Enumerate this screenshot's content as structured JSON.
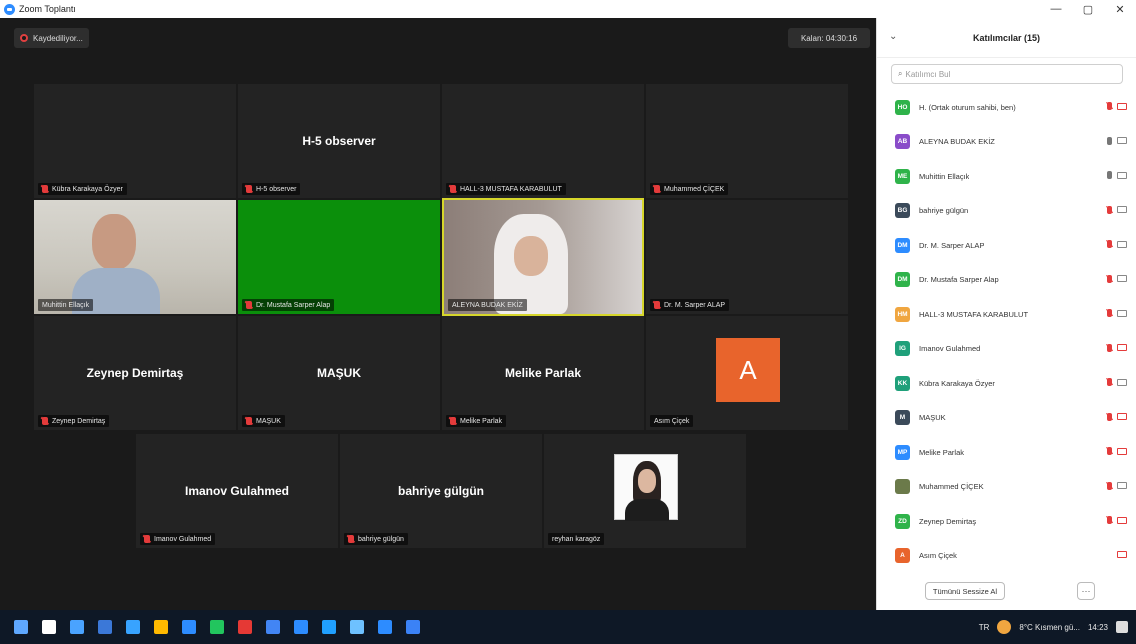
{
  "window": {
    "title": "Zoom Toplantı",
    "controls": [
      "—",
      "▢",
      "✕"
    ]
  },
  "recording": {
    "label": "Kaydediliyor..."
  },
  "timer": {
    "label": "Kalan: 04:30:16"
  },
  "tiles": [
    {
      "center": "",
      "label": "Kübra Karakaya Özyer",
      "muted": true
    },
    {
      "center": "H-5 observer",
      "label": "H-5 observer",
      "muted": true
    },
    {
      "center": "",
      "label": "HALL-3 MUSTAFA KARABULUT",
      "muted": true
    },
    {
      "center": "",
      "label": "Muhammed ÇİÇEK",
      "muted": true
    },
    {
      "center": "",
      "label": "Muhittin Ellaçık",
      "muted": false
    },
    {
      "center": "",
      "label": "Dr. Mustafa Sarper Alap",
      "muted": true
    },
    {
      "center": "",
      "label": "ALEYNA BUDAK EKİZ",
      "muted": false
    },
    {
      "center": "",
      "label": "Dr. M. Sarper ALAP",
      "muted": true
    },
    {
      "center": "Zeynep Demirtaş",
      "label": "Zeynep Demirtaş",
      "muted": true
    },
    {
      "center": "MAŞUK",
      "label": "MAŞUK",
      "muted": true
    },
    {
      "center": "Melike Parlak",
      "label": "Melike Parlak",
      "muted": true
    },
    {
      "center": "A",
      "label": "Asım Çiçek",
      "muted": false
    },
    {
      "center": "Imanov Gulahmed",
      "label": "Imanov Gulahmed",
      "muted": true
    },
    {
      "center": "bahriye gülgün",
      "label": "bahriye gülgün",
      "muted": true
    },
    {
      "center": "",
      "label": "reyhan karagöz",
      "muted": false
    }
  ],
  "panel": {
    "title": "Katılımcılar (15)",
    "search_placeholder": "Katılımcı Bul",
    "participants": [
      {
        "initials": "HO",
        "name": "H. (Ortak oturum sahibi, ben)",
        "color": "#2fb34a",
        "mic": "off",
        "cam": "off"
      },
      {
        "initials": "AB",
        "name": "ALEYNA BUDAK EKİZ",
        "color": "#8a4cc9",
        "mic": "on",
        "cam": "on"
      },
      {
        "initials": "ME",
        "name": "Muhittin Ellaçık",
        "color": "#2fb34a",
        "mic": "on",
        "cam": "on"
      },
      {
        "initials": "BG",
        "name": "bahriye gülgün",
        "color": "#3b4a5a",
        "mic": "off",
        "cam": "on"
      },
      {
        "initials": "DM",
        "name": "Dr. M. Sarper ALAP",
        "color": "#2d8cff",
        "mic": "off",
        "cam": "on"
      },
      {
        "initials": "DM",
        "name": "Dr. Mustafa Sarper Alap",
        "color": "#2fb34a",
        "mic": "off",
        "cam": "on"
      },
      {
        "initials": "HM",
        "name": "HALL-3 MUSTAFA KARABULUT",
        "color": "#f0a640",
        "mic": "off",
        "cam": "on"
      },
      {
        "initials": "IG",
        "name": "Imanov Gulahmed",
        "color": "#1fa07a",
        "mic": "off",
        "cam": "off"
      },
      {
        "initials": "KK",
        "name": "Kübra Karakaya Özyer",
        "color": "#1fa07a",
        "mic": "off",
        "cam": "on"
      },
      {
        "initials": "M",
        "name": "MAŞUK",
        "color": "#3b4a5a",
        "mic": "off",
        "cam": "off"
      },
      {
        "initials": "MP",
        "name": "Melike Parlak",
        "color": "#2d8cff",
        "mic": "off",
        "cam": "off"
      },
      {
        "initials": "",
        "name": "Muhammed ÇİÇEK",
        "color": "#6b7a4a",
        "mic": "off",
        "cam": "on"
      },
      {
        "initials": "ZD",
        "name": "Zeynep Demirtaş",
        "color": "#2fb34a",
        "mic": "off",
        "cam": "off"
      },
      {
        "initials": "A",
        "name": "Asım Çiçek",
        "color": "#e8642c",
        "mic": "",
        "cam": "off"
      }
    ],
    "mute_all_label": "Tümünü Sessize Al",
    "more_label": "···"
  },
  "taskbar": {
    "icons": [
      "#5fa8ff",
      "#ffffff",
      "#4aa3ff",
      "#3b78d8",
      "#38a3ff",
      "#ffb900",
      "#2d8cff",
      "#22c55e",
      "#e53935",
      "#4285f4",
      "#2d8cff",
      "#20a0ff",
      "#6ec1ff",
      "#2d8cff",
      "#3b82f6"
    ],
    "lang": "TR",
    "weather": "8°C Kısmen gü...",
    "time": "14:23"
  }
}
